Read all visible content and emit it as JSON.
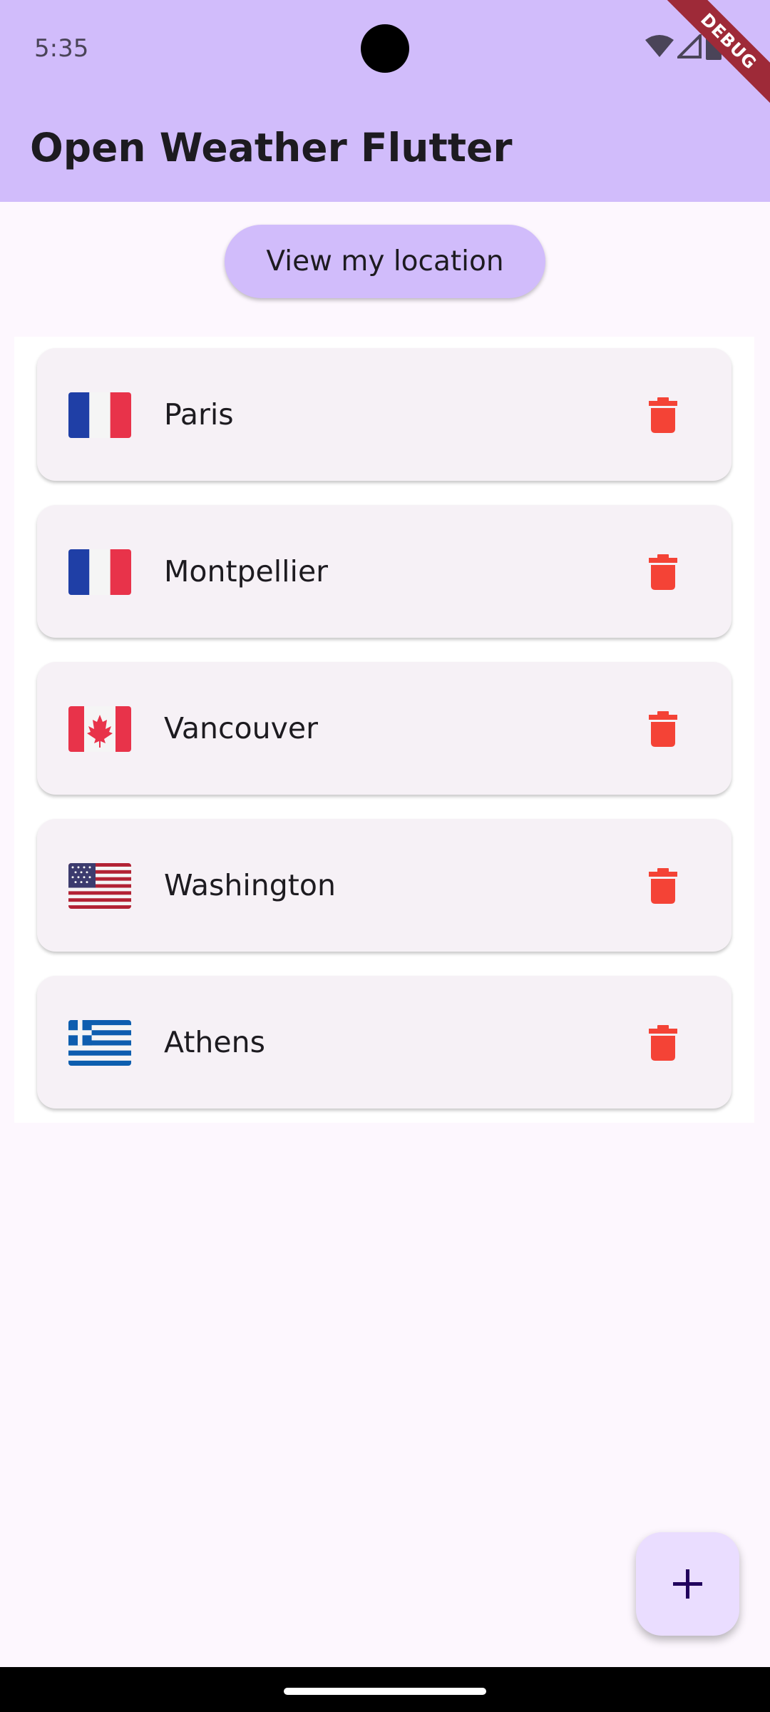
{
  "status_bar": {
    "time": "5:35",
    "icons": [
      "wifi-icon",
      "signal-icon",
      "battery-icon"
    ],
    "debug_label": "DEBUG"
  },
  "app_bar": {
    "title": "Open Weather Flutter",
    "color": "#D1BCFB"
  },
  "location_button": {
    "label": "View my location"
  },
  "cities": [
    {
      "name": "Paris",
      "country_flag": "france-flag-icon"
    },
    {
      "name": "Montpellier",
      "country_flag": "france-flag-icon"
    },
    {
      "name": "Vancouver",
      "country_flag": "canada-flag-icon"
    },
    {
      "name": "Washington",
      "country_flag": "usa-flag-icon"
    },
    {
      "name": "Athens",
      "country_flag": "greece-flag-icon"
    }
  ],
  "delete_icon": "trash-icon",
  "delete_color": "#F44336",
  "fab": {
    "icon": "plus-icon",
    "color": "#EADDFF"
  }
}
